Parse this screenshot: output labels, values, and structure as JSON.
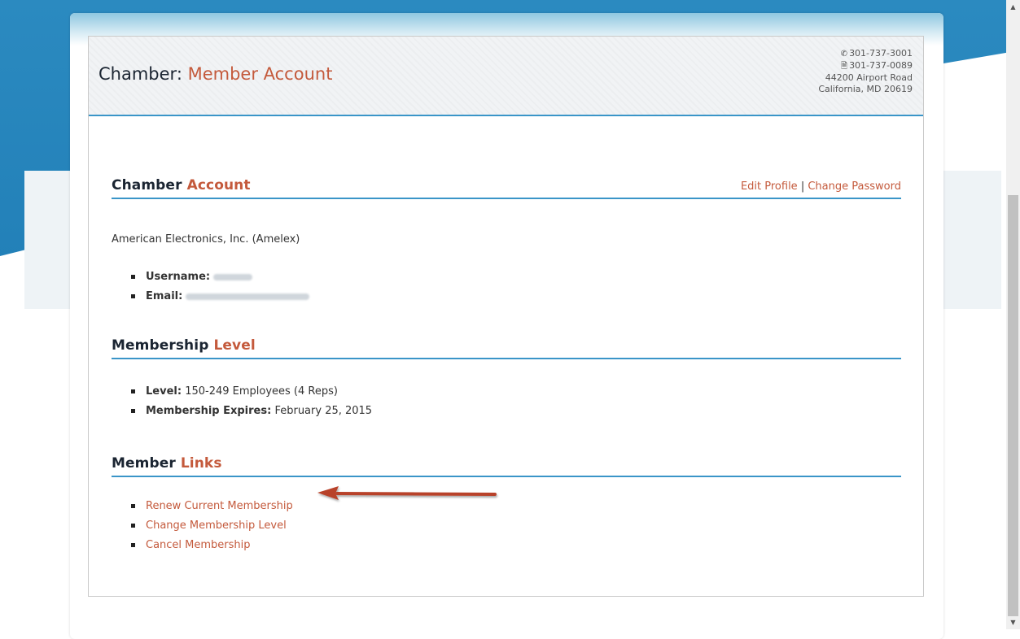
{
  "header": {
    "title_prefix": "Chamber:",
    "title_accent": "Member Account",
    "phone": "301-737-3001",
    "fax": "301-737-0089",
    "address_line1": "44200 Airport Road",
    "address_line2": "California, MD 20619"
  },
  "account": {
    "heading_prefix": "Chamber",
    "heading_accent": "Account",
    "edit_profile": "Edit Profile",
    "separator": "|",
    "change_password": "Change Password",
    "company": "American Electronics, Inc. (Amelex)",
    "username_label": "Username:",
    "email_label": "Email:"
  },
  "membership": {
    "heading_prefix": "Membership",
    "heading_accent": "Level",
    "level_label": "Level:",
    "level_value": "150-249 Employees (4 Reps)",
    "expires_label": "Membership Expires:",
    "expires_value": "February 25, 2015"
  },
  "links": {
    "heading_prefix": "Member",
    "heading_accent": "Links",
    "items": [
      "Renew Current Membership",
      "Change Membership Level",
      "Cancel Membership"
    ]
  },
  "colors": {
    "accent": "#c45a3c",
    "rule_blue": "#3a95c8",
    "bg_blue": "#2280b8"
  },
  "icons": {
    "phone": "phone-icon",
    "fax": "fax-icon",
    "arrow": "annotation-arrow-icon"
  }
}
